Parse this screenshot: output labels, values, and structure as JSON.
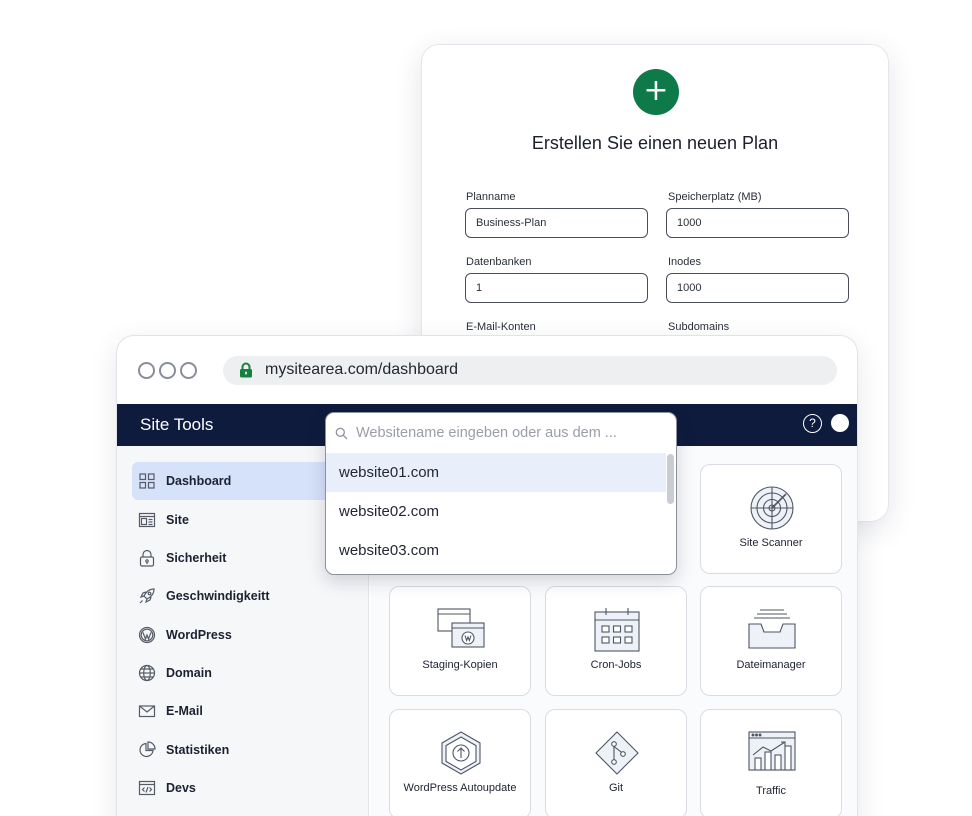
{
  "plan_form": {
    "title": "Erstellen Sie einen neuen Plan",
    "fields": [
      {
        "label": "Planname",
        "value": "Business-Plan"
      },
      {
        "label": "Speicherplatz (MB)",
        "value": "1000"
      },
      {
        "label": "Datenbanken",
        "value": "1"
      },
      {
        "label": "Inodes",
        "value": "1000"
      },
      {
        "label": "E-Mail-Konten",
        "value": ""
      },
      {
        "label": "Subdomains",
        "value": ""
      }
    ]
  },
  "browser": {
    "url": "mysitearea.com/dashboard"
  },
  "appbar": {
    "title": "Site Tools",
    "help": "?"
  },
  "site_picker": {
    "placeholder": "Websitename eingeben oder aus dem ...",
    "options": [
      "website01.com",
      "website02.com",
      "website03.com"
    ],
    "selected": "website01.com"
  },
  "sidebar": {
    "items": [
      {
        "label": "Dashboard",
        "icon": "dashboard-icon",
        "active": true
      },
      {
        "label": "Site",
        "icon": "site-icon"
      },
      {
        "label": "Sicherheit",
        "icon": "lock-icon"
      },
      {
        "label": "Geschwindigkeitt",
        "icon": "rocket-icon"
      },
      {
        "label": "WordPress",
        "icon": "wordpress-icon"
      },
      {
        "label": "Domain",
        "icon": "globe-icon"
      },
      {
        "label": "E-Mail",
        "icon": "mail-icon"
      },
      {
        "label": "Statistiken",
        "icon": "pie-chart-icon"
      },
      {
        "label": "Devs",
        "icon": "code-icon"
      }
    ]
  },
  "tiles": [
    {
      "label": "Site Scanner",
      "icon": "radar-icon"
    },
    {
      "label": "Staging-Kopien",
      "icon": "staging-icon"
    },
    {
      "label": "Cron-Jobs",
      "icon": "calendar-icon"
    },
    {
      "label": "Dateimanager",
      "icon": "file-tray-icon"
    },
    {
      "label": "WordPress Autoupdate",
      "icon": "update-icon"
    },
    {
      "label": "Git",
      "icon": "git-icon"
    },
    {
      "label": "Traffic",
      "icon": "traffic-chart-icon"
    }
  ],
  "colors": {
    "brand_green": "#0e7a4a",
    "navy": "#0f1b3d",
    "active_item": "#d6e2fa",
    "lock_green": "#17803f"
  }
}
